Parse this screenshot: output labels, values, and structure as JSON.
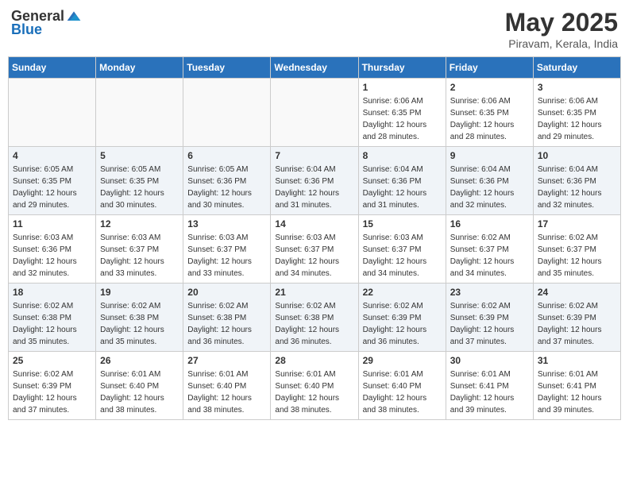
{
  "header": {
    "logo_general": "General",
    "logo_blue": "Blue",
    "month": "May 2025",
    "location": "Piravam, Kerala, India"
  },
  "days_of_week": [
    "Sunday",
    "Monday",
    "Tuesday",
    "Wednesday",
    "Thursday",
    "Friday",
    "Saturday"
  ],
  "weeks": [
    [
      {
        "day": "",
        "empty": true
      },
      {
        "day": "",
        "empty": true
      },
      {
        "day": "",
        "empty": true
      },
      {
        "day": "",
        "empty": true
      },
      {
        "day": "1",
        "sunrise": "6:06 AM",
        "sunset": "6:35 PM",
        "daylight": "12 hours and 28 minutes."
      },
      {
        "day": "2",
        "sunrise": "6:06 AM",
        "sunset": "6:35 PM",
        "daylight": "12 hours and 28 minutes."
      },
      {
        "day": "3",
        "sunrise": "6:06 AM",
        "sunset": "6:35 PM",
        "daylight": "12 hours and 29 minutes."
      }
    ],
    [
      {
        "day": "4",
        "sunrise": "6:05 AM",
        "sunset": "6:35 PM",
        "daylight": "12 hours and 29 minutes."
      },
      {
        "day": "5",
        "sunrise": "6:05 AM",
        "sunset": "6:35 PM",
        "daylight": "12 hours and 30 minutes."
      },
      {
        "day": "6",
        "sunrise": "6:05 AM",
        "sunset": "6:36 PM",
        "daylight": "12 hours and 30 minutes."
      },
      {
        "day": "7",
        "sunrise": "6:04 AM",
        "sunset": "6:36 PM",
        "daylight": "12 hours and 31 minutes."
      },
      {
        "day": "8",
        "sunrise": "6:04 AM",
        "sunset": "6:36 PM",
        "daylight": "12 hours and 31 minutes."
      },
      {
        "day": "9",
        "sunrise": "6:04 AM",
        "sunset": "6:36 PM",
        "daylight": "12 hours and 32 minutes."
      },
      {
        "day": "10",
        "sunrise": "6:04 AM",
        "sunset": "6:36 PM",
        "daylight": "12 hours and 32 minutes."
      }
    ],
    [
      {
        "day": "11",
        "sunrise": "6:03 AM",
        "sunset": "6:36 PM",
        "daylight": "12 hours and 32 minutes."
      },
      {
        "day": "12",
        "sunrise": "6:03 AM",
        "sunset": "6:37 PM",
        "daylight": "12 hours and 33 minutes."
      },
      {
        "day": "13",
        "sunrise": "6:03 AM",
        "sunset": "6:37 PM",
        "daylight": "12 hours and 33 minutes."
      },
      {
        "day": "14",
        "sunrise": "6:03 AM",
        "sunset": "6:37 PM",
        "daylight": "12 hours and 34 minutes."
      },
      {
        "day": "15",
        "sunrise": "6:03 AM",
        "sunset": "6:37 PM",
        "daylight": "12 hours and 34 minutes."
      },
      {
        "day": "16",
        "sunrise": "6:02 AM",
        "sunset": "6:37 PM",
        "daylight": "12 hours and 34 minutes."
      },
      {
        "day": "17",
        "sunrise": "6:02 AM",
        "sunset": "6:37 PM",
        "daylight": "12 hours and 35 minutes."
      }
    ],
    [
      {
        "day": "18",
        "sunrise": "6:02 AM",
        "sunset": "6:38 PM",
        "daylight": "12 hours and 35 minutes."
      },
      {
        "day": "19",
        "sunrise": "6:02 AM",
        "sunset": "6:38 PM",
        "daylight": "12 hours and 35 minutes."
      },
      {
        "day": "20",
        "sunrise": "6:02 AM",
        "sunset": "6:38 PM",
        "daylight": "12 hours and 36 minutes."
      },
      {
        "day": "21",
        "sunrise": "6:02 AM",
        "sunset": "6:38 PM",
        "daylight": "12 hours and 36 minutes."
      },
      {
        "day": "22",
        "sunrise": "6:02 AM",
        "sunset": "6:39 PM",
        "daylight": "12 hours and 36 minutes."
      },
      {
        "day": "23",
        "sunrise": "6:02 AM",
        "sunset": "6:39 PM",
        "daylight": "12 hours and 37 minutes."
      },
      {
        "day": "24",
        "sunrise": "6:02 AM",
        "sunset": "6:39 PM",
        "daylight": "12 hours and 37 minutes."
      }
    ],
    [
      {
        "day": "25",
        "sunrise": "6:02 AM",
        "sunset": "6:39 PM",
        "daylight": "12 hours and 37 minutes."
      },
      {
        "day": "26",
        "sunrise": "6:01 AM",
        "sunset": "6:40 PM",
        "daylight": "12 hours and 38 minutes."
      },
      {
        "day": "27",
        "sunrise": "6:01 AM",
        "sunset": "6:40 PM",
        "daylight": "12 hours and 38 minutes."
      },
      {
        "day": "28",
        "sunrise": "6:01 AM",
        "sunset": "6:40 PM",
        "daylight": "12 hours and 38 minutes."
      },
      {
        "day": "29",
        "sunrise": "6:01 AM",
        "sunset": "6:40 PM",
        "daylight": "12 hours and 38 minutes."
      },
      {
        "day": "30",
        "sunrise": "6:01 AM",
        "sunset": "6:41 PM",
        "daylight": "12 hours and 39 minutes."
      },
      {
        "day": "31",
        "sunrise": "6:01 AM",
        "sunset": "6:41 PM",
        "daylight": "12 hours and 39 minutes."
      }
    ]
  ],
  "labels": {
    "sunrise": "Sunrise:",
    "sunset": "Sunset:",
    "daylight": "Daylight:"
  }
}
